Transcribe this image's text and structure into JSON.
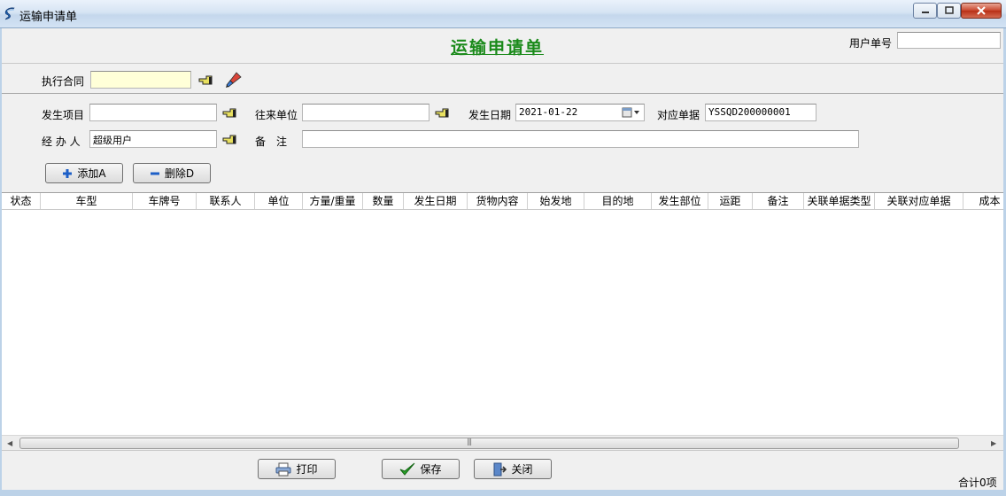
{
  "window": {
    "title": "运输申请单"
  },
  "form": {
    "title": "运输申请单"
  },
  "user_doc": {
    "label": "用户单号",
    "value": ""
  },
  "contract": {
    "label": "执行合同",
    "value": ""
  },
  "fields": {
    "project": {
      "label": "发生项目",
      "value": ""
    },
    "partner": {
      "label": "往来单位",
      "value": ""
    },
    "date": {
      "label": "发生日期",
      "value": "2021-01-22"
    },
    "doc_no": {
      "label": "对应单据",
      "value": "YSSQD200000001"
    },
    "handler": {
      "label": "经 办 人",
      "value": "超级用户"
    },
    "remark": {
      "label": "备　注",
      "value": ""
    }
  },
  "buttons": {
    "add": "添加A",
    "delete": "删除D",
    "print": "打印",
    "save": "保存",
    "close": "关闭"
  },
  "grid": {
    "columns": [
      "状态",
      "车型",
      "车牌号",
      "联系人",
      "单位",
      "方量/重量",
      "数量",
      "发生日期",
      "货物内容",
      "始发地",
      "目的地",
      "发生部位",
      "运距",
      "备注",
      "关联单据类型",
      "关联对应单据",
      "成本"
    ]
  },
  "footer": {
    "total": "合计0项"
  },
  "colors": {
    "title_green": "#1a8a1a",
    "contract_yellow": "#ffffd8"
  }
}
